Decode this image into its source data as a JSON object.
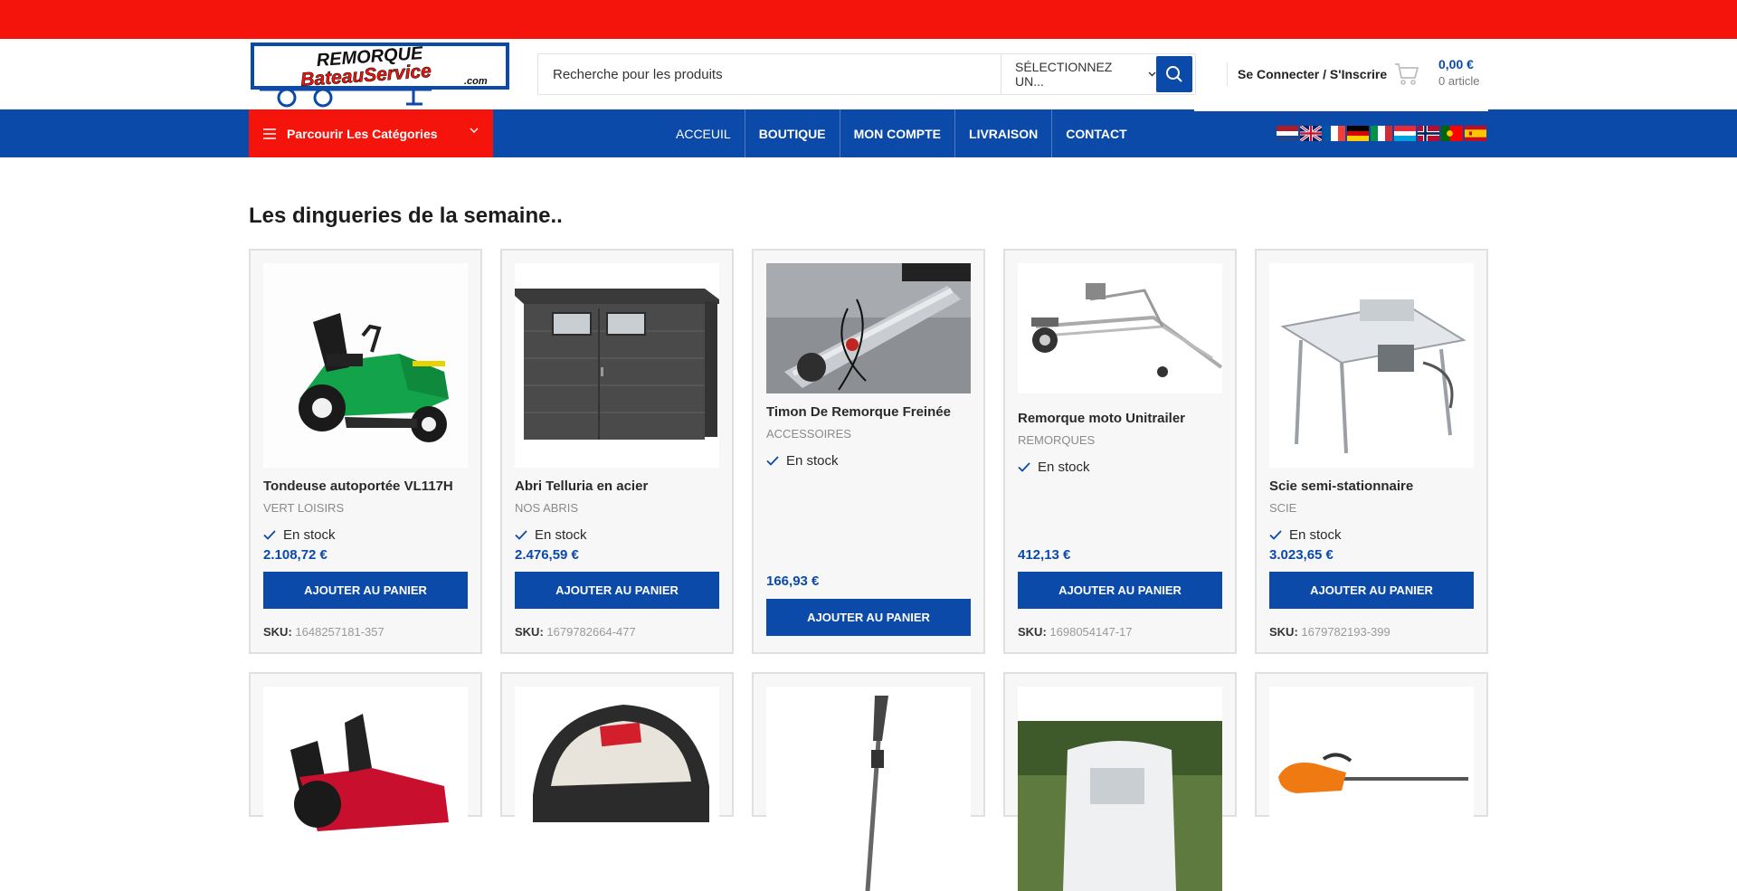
{
  "brand": {
    "line1": "REMORQUE",
    "line2": "BateauService",
    "line3": ".com",
    "colors": {
      "topbar": "#f4140c",
      "primary": "#0b4aa8",
      "accent": "#f4140c"
    }
  },
  "search": {
    "placeholder": "Recherche pour les produits",
    "category": "SÉLECTIONNEZ UN...",
    "icon": "search-icon"
  },
  "account": {
    "label": "Se Connecter / S'Inscrire"
  },
  "cart": {
    "amount": "0,00 €",
    "count": "0 article",
    "icon": "cart-icon"
  },
  "nav": {
    "browse_label": "Parcourir Les Catégories",
    "items": [
      {
        "label": "ACCEUIL"
      },
      {
        "label": "BOUTIQUE"
      },
      {
        "label": "MON COMPTE"
      },
      {
        "label": "LIVRAISON"
      },
      {
        "label": "CONTACT"
      }
    ],
    "flags": [
      "nl",
      "gb",
      "fr",
      "de",
      "it",
      "lu",
      "no",
      "pt",
      "es"
    ]
  },
  "section": {
    "title": "Les dingueries de la semaine.."
  },
  "products": [
    {
      "title": "Tondeuse autoportée VL117H",
      "category": "VERT LOISIRS",
      "stock": "En stock",
      "price": "2.108,72 €",
      "button": "AJOUTER AU PANIER",
      "sku_label": "SKU:",
      "sku": "1648257181-357",
      "image": "riding-mower-green"
    },
    {
      "title": "Abri Telluria en acier",
      "category": "NOS ABRIS",
      "stock": "En stock",
      "price": "2.476,59 €",
      "button": "AJOUTER AU PANIER",
      "sku_label": "SKU:",
      "sku": "1679782664-477",
      "image": "steel-shed"
    },
    {
      "title": "Timon De Remorque Freinée",
      "category": "ACCESSOIRES",
      "stock": "En stock",
      "price": "166,93 €",
      "button": "AJOUTER AU PANIER",
      "image": "trailer-drawbar"
    },
    {
      "title": "Remorque moto Unitrailer",
      "category": "REMORQUES",
      "stock": "En stock",
      "price": "412,13 €",
      "button": "AJOUTER AU PANIER",
      "sku_label": "SKU:",
      "sku": "1698054147-17",
      "image": "motorcycle-trailer"
    },
    {
      "title": "Scie semi-stationnaire",
      "category": "SCIE",
      "stock": "En stock",
      "price": "3.023,65 €",
      "button": "AJOUTER AU PANIER",
      "sku_label": "SKU:",
      "sku": "1679782193-399",
      "image": "table-saw"
    }
  ],
  "products_row2": [
    {
      "image": "riding-mower-red"
    },
    {
      "image": "robot-mower"
    },
    {
      "image": "hedge-trimmer-pole"
    },
    {
      "image": "horse-trailer"
    },
    {
      "image": "hedge-trimmer-orange"
    }
  ]
}
